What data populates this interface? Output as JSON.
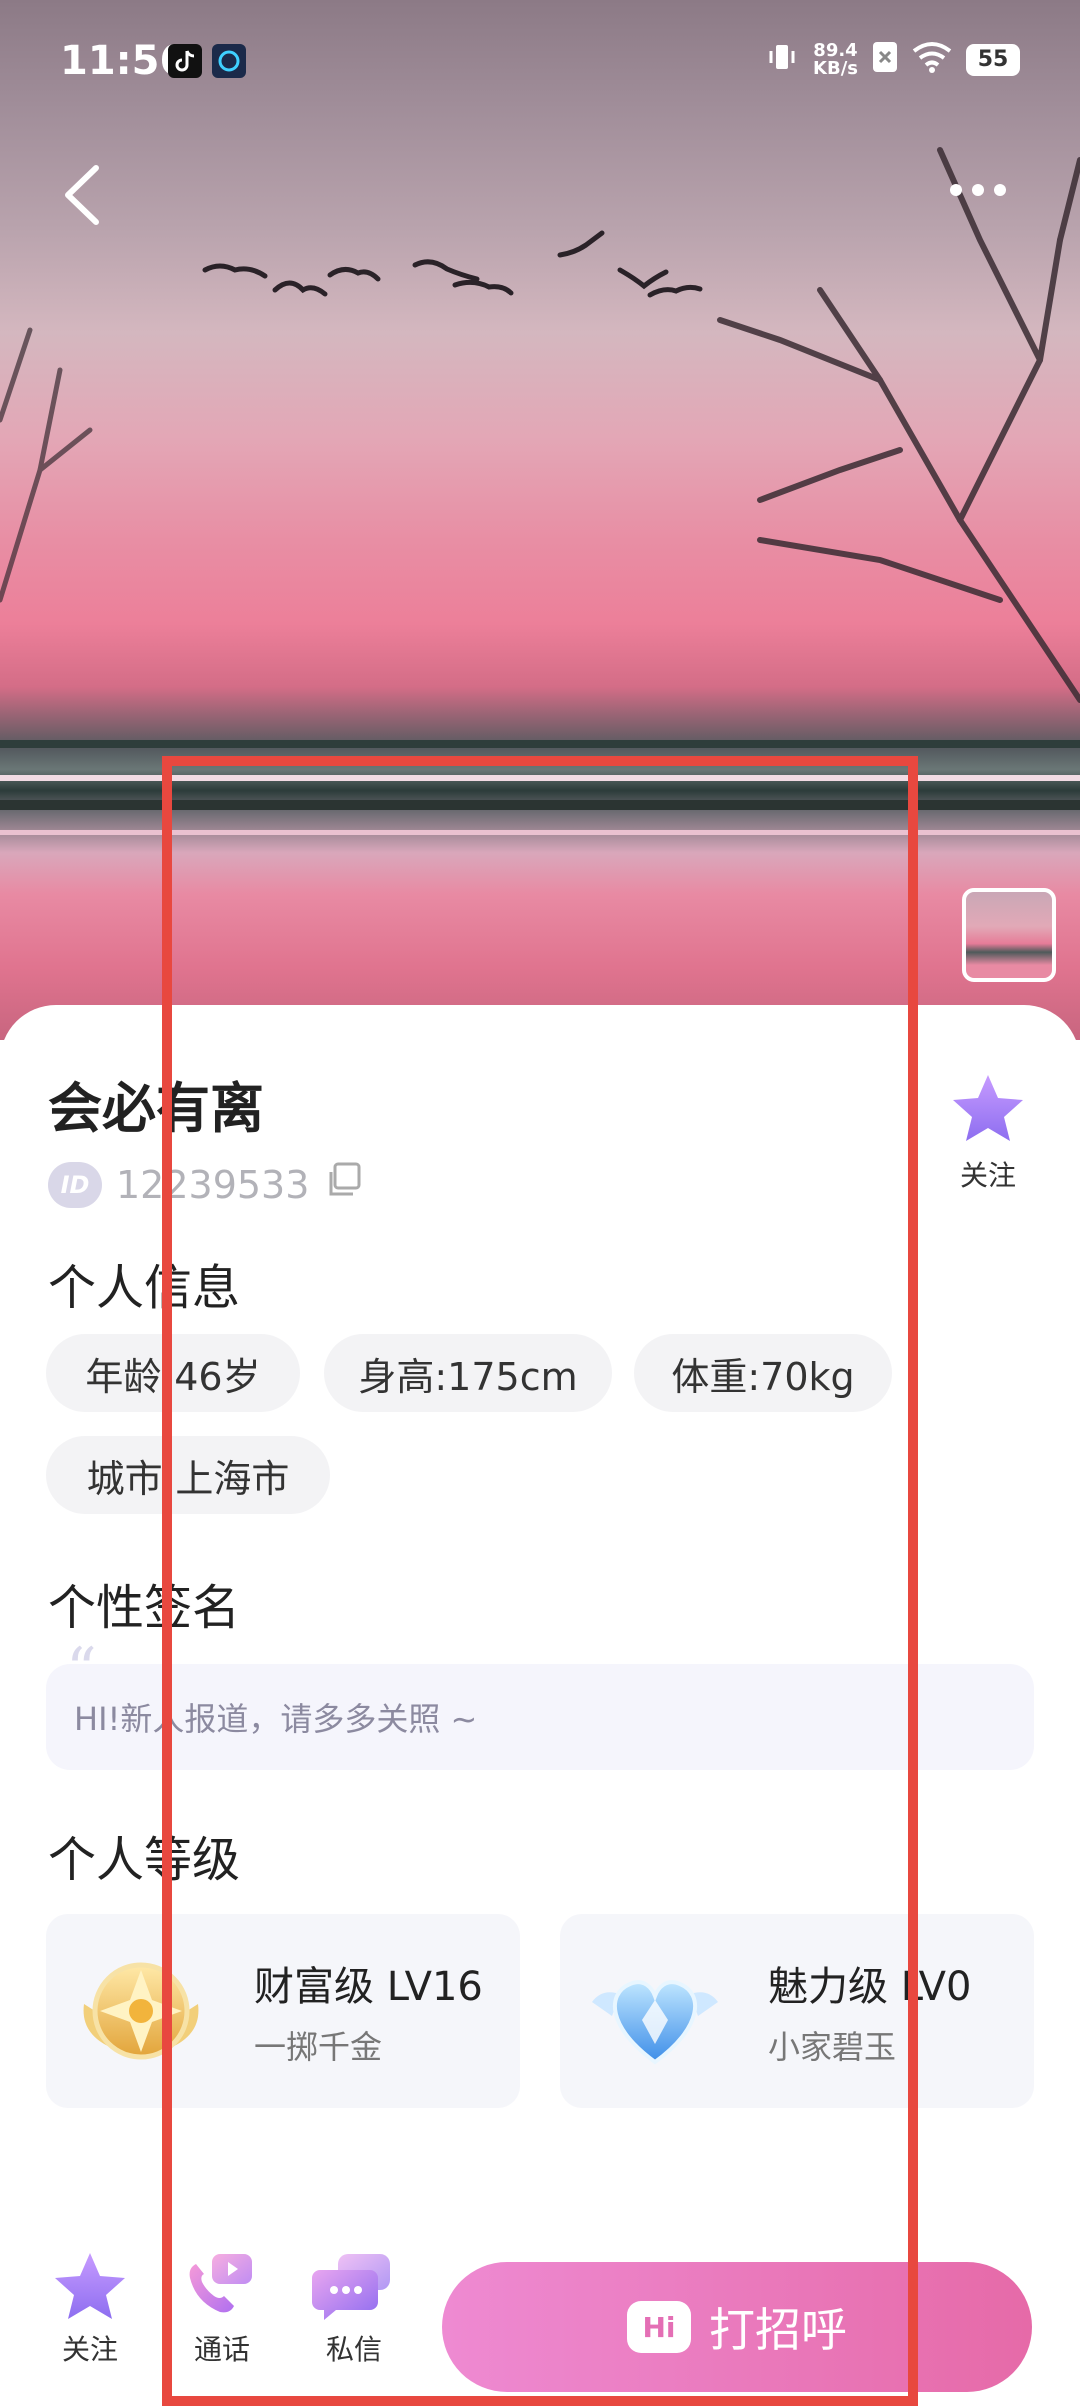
{
  "status_bar": {
    "time": "11:56",
    "speed_value": "89.4",
    "speed_unit": "KB/s",
    "battery": "55"
  },
  "header": {
    "back_icon": "chevron-left-icon",
    "more_icon": "more-dots-icon"
  },
  "profile": {
    "name": "会必有离",
    "id_badge": "ID",
    "id_number": "12239533",
    "follow_label": "关注"
  },
  "personal_info": {
    "title": "个人信息",
    "chips": [
      "年龄:46岁",
      "身高:175cm",
      "体重:70kg",
      "城市:上海市"
    ]
  },
  "signature": {
    "title": "个性签名",
    "quote_mark": "“",
    "text": "HI!新人报道，请多多关照 ~"
  },
  "levels": {
    "title": "个人等级",
    "items": [
      {
        "title": "财富级 LV16",
        "subtitle": "一掷千金",
        "icon": "gold-medal-icon"
      },
      {
        "title": "魅力级 LV0",
        "subtitle": "小家碧玉",
        "icon": "blue-heart-icon"
      }
    ]
  },
  "bottom_bar": {
    "follow_label": "关注",
    "call_label": "通话",
    "message_label": "私信",
    "greet_badge": "Hi",
    "greet_label": "打招呼"
  },
  "colors": {
    "accent_purple": "#9d7cf0",
    "greet_gradient_start": "#ee8ad2",
    "greet_gradient_end": "#e66aa8",
    "highlight_red": "#e8483f"
  }
}
